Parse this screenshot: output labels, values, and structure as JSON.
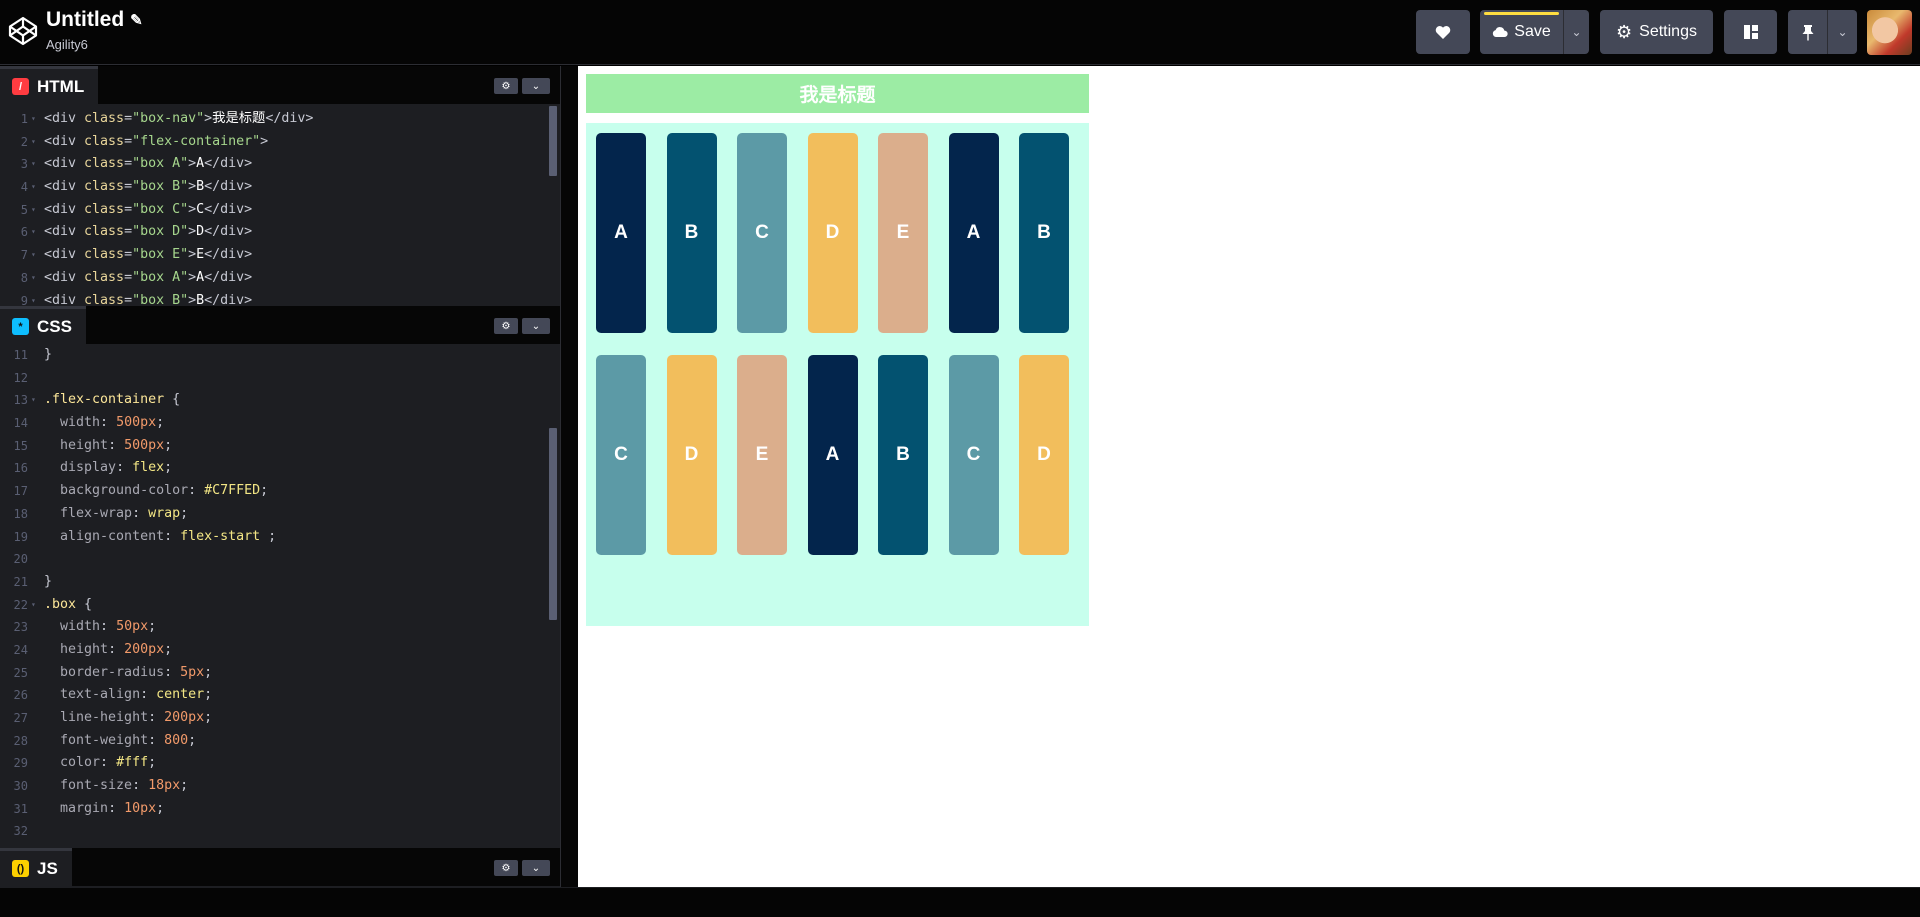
{
  "header": {
    "title": "Untitled",
    "username": "Agility6",
    "save_label": "Save",
    "settings_label": "Settings"
  },
  "panes": {
    "html_label": "HTML",
    "css_label": "CSS",
    "js_label": "JS"
  },
  "html_code": {
    "line_numbers": [
      "1",
      "2",
      "3",
      "4",
      "5",
      "6",
      "7",
      "8",
      "9"
    ],
    "lines": [
      {
        "tag_open": "<div ",
        "attr": "class",
        "eq": "=",
        "str": "\"box-nav\"",
        "close": ">",
        "text": "我是标题",
        "end": "</div>"
      },
      {
        "tag_open": "<div ",
        "attr": "class",
        "eq": "=",
        "str": "\"flex-container\"",
        "close": ">",
        "text": "",
        "end": ""
      },
      {
        "tag_open": "<div ",
        "attr": "class",
        "eq": "=",
        "str": "\"box A\"",
        "close": ">",
        "text": "A",
        "end": "</div>"
      },
      {
        "tag_open": "<div ",
        "attr": "class",
        "eq": "=",
        "str": "\"box B\"",
        "close": ">",
        "text": "B",
        "end": "</div>"
      },
      {
        "tag_open": "<div ",
        "attr": "class",
        "eq": "=",
        "str": "\"box C\"",
        "close": ">",
        "text": "C",
        "end": "</div>"
      },
      {
        "tag_open": "<div ",
        "attr": "class",
        "eq": "=",
        "str": "\"box D\"",
        "close": ">",
        "text": "D",
        "end": "</div>"
      },
      {
        "tag_open": "<div ",
        "attr": "class",
        "eq": "=",
        "str": "\"box E\"",
        "close": ">",
        "text": "E",
        "end": "</div>"
      },
      {
        "tag_open": "<div ",
        "attr": "class",
        "eq": "=",
        "str": "\"box A\"",
        "close": ">",
        "text": "A",
        "end": "</div>"
      },
      {
        "tag_open": "<div ",
        "attr": "class",
        "eq": "=",
        "str": "\"box B\"",
        "close": ">",
        "text": "B",
        "end": "</div>"
      }
    ]
  },
  "css_code": {
    "line_numbers": [
      "11",
      "12",
      "13",
      "14",
      "15",
      "16",
      "17",
      "18",
      "19",
      "20",
      "21",
      "22",
      "23",
      "24",
      "25",
      "26",
      "27",
      "28",
      "29",
      "30",
      "31",
      "32"
    ],
    "l11": "}",
    "l13_sel": ".flex-container",
    "l13_brace": " {",
    "decls": [
      {
        "prop": "width",
        "val": "500px",
        "kind": "num"
      },
      {
        "prop": "height",
        "val": "500px",
        "kind": "num"
      },
      {
        "prop": "display",
        "val": "flex",
        "kind": "val"
      },
      {
        "prop": "background-color",
        "val": "#C7FFED",
        "kind": "val"
      },
      {
        "prop": "flex-wrap",
        "val": "wrap",
        "kind": "val"
      },
      {
        "prop": "align-content",
        "val": "flex-start ",
        "kind": "val"
      }
    ],
    "l21": "}",
    "l22_sel": ".box",
    "l22_brace": " {",
    "box_decls": [
      {
        "prop": "width",
        "val": "50px",
        "kind": "num"
      },
      {
        "prop": "height",
        "val": "200px",
        "kind": "num"
      },
      {
        "prop": "border-radius",
        "val": "5px",
        "kind": "num"
      },
      {
        "prop": "text-align",
        "val": "center",
        "kind": "val"
      },
      {
        "prop": "line-height",
        "val": "200px",
        "kind": "num"
      },
      {
        "prop": "font-weight",
        "val": "800",
        "kind": "num"
      },
      {
        "prop": "color",
        "val": "#fff",
        "kind": "val"
      },
      {
        "prop": "font-size",
        "val": "18px",
        "kind": "num"
      },
      {
        "prop": "margin",
        "val": "10px",
        "kind": "num"
      }
    ]
  },
  "preview": {
    "nav_title": "我是标题",
    "boxes": [
      {
        "label": "A",
        "color": "#03254c"
      },
      {
        "label": "B",
        "color": "#035270"
      },
      {
        "label": "C",
        "color": "#5c9aa6"
      },
      {
        "label": "D",
        "color": "#f2be5c"
      },
      {
        "label": "E",
        "color": "#dbae8c"
      },
      {
        "label": "A",
        "color": "#03254c"
      },
      {
        "label": "B",
        "color": "#035270"
      },
      {
        "label": "C",
        "color": "#5c9aa6"
      },
      {
        "label": "D",
        "color": "#f2be5c"
      },
      {
        "label": "E",
        "color": "#dbae8c"
      },
      {
        "label": "A",
        "color": "#03254c"
      },
      {
        "label": "B",
        "color": "#035270"
      },
      {
        "label": "C",
        "color": "#5c9aa6"
      },
      {
        "label": "D",
        "color": "#f2be5c"
      }
    ]
  },
  "icons": {
    "logo": "codepen-logo-icon",
    "edit": "pencil-icon",
    "like": "heart-icon",
    "save": "cloud-icon",
    "settings": "gear-icon",
    "layout": "layout-icon",
    "pin": "pin-icon",
    "dropdown": "chevron-down-icon"
  }
}
